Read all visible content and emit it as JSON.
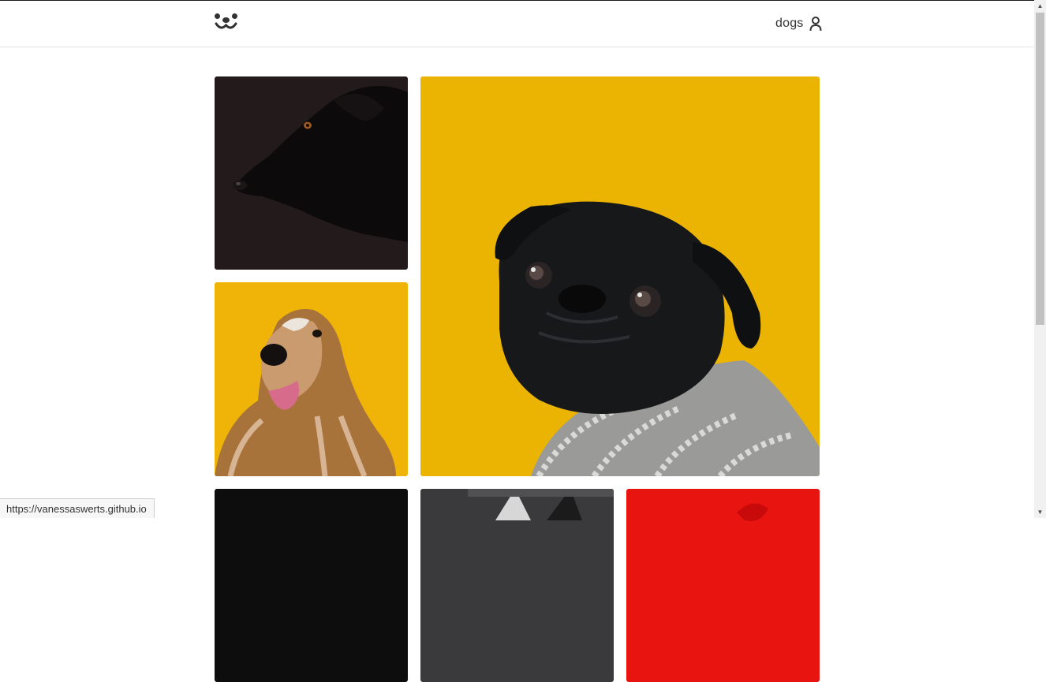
{
  "header": {
    "logo_icon": "dog-face-icon",
    "account_label": "dogs",
    "account_icon": "user-icon"
  },
  "feed": {
    "photos": [
      {
        "subject": "black dog profile",
        "background": "#231a1b"
      },
      {
        "subject": "black pug in knit sweater",
        "background": "#ebb302"
      },
      {
        "subject": "afghan hound",
        "background": "#f0b307"
      },
      {
        "subject": "dark photo",
        "background": "#0d0d0d"
      },
      {
        "subject": "dog ears",
        "background": "#3a3a3c"
      },
      {
        "subject": "red background photo",
        "background": "#e8140f"
      }
    ]
  },
  "status_bar": {
    "url": "https://vanessaswerts.github.io"
  }
}
